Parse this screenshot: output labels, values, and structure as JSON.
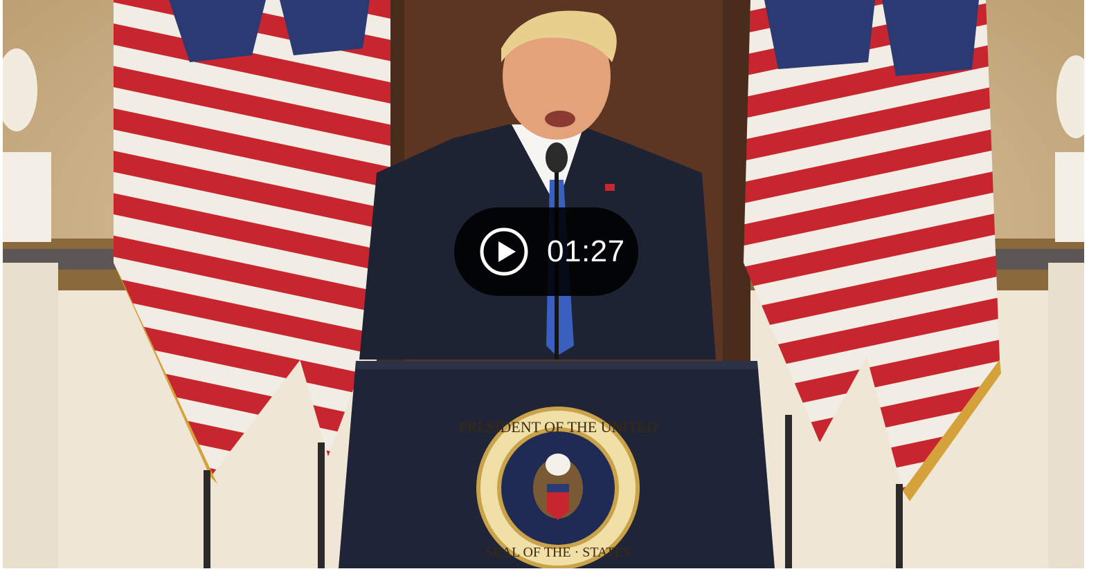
{
  "video": {
    "duration": "01:27",
    "seal_text_top": "PRESIDENT OF THE UNITED",
    "seal_text_bottom": "SEAL OF THE · STATES"
  },
  "colors": {
    "overlay_bg": "#000000",
    "overlay_text": "#ffffff",
    "flag_red": "#c8262e",
    "flag_blue": "#2b3a73",
    "podium": "#1f2436",
    "seal_gold": "#c9a24a"
  },
  "icons": {
    "play": "play-circle-icon"
  }
}
